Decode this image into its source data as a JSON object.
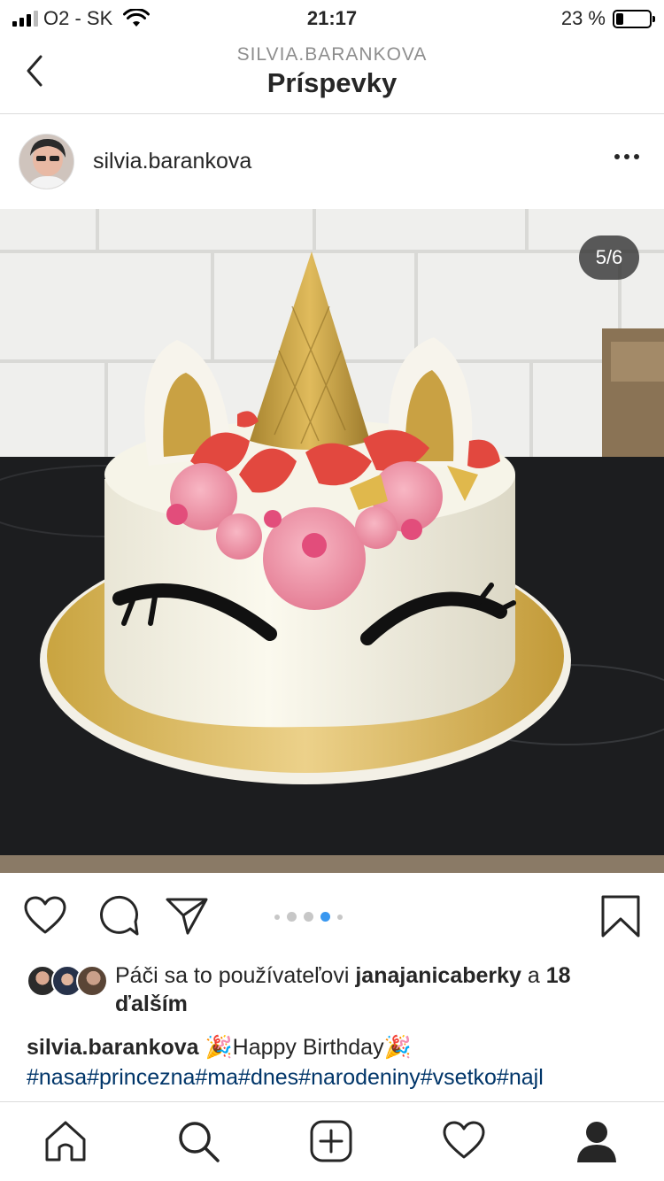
{
  "status_bar": {
    "carrier": "O2 - SK",
    "time": "21:17",
    "battery_percent_label": "23 %",
    "battery_level": 0.23
  },
  "header": {
    "subtitle": "SILVIA.BARANKOVA",
    "title": "Príspevky",
    "back_icon": "chevron-left-icon"
  },
  "post": {
    "username": "silvia.barankova",
    "more_icon": "ellipsis-icon",
    "image_counter": "5/6",
    "carousel": {
      "total_dots": 5,
      "active_index": 3
    },
    "actions": [
      "heart-icon",
      "comment-icon",
      "share-icon",
      "bookmark-icon"
    ],
    "likes": {
      "prefix": "Páči sa to používateľovi",
      "liker": "janajanicaberky",
      "connector": "a",
      "others": "18 ďalším"
    },
    "caption": {
      "author": "silvia.barankova",
      "text": "🎉Happy Birthday🎉",
      "hashtags": "#nasa#princezna#ma#dnes#narodeniny#vsetko#najl"
    }
  },
  "tab_bar": [
    "home-icon",
    "search-icon",
    "new-post-icon",
    "activity-heart-icon",
    "profile-icon"
  ],
  "colors": {
    "link": "#003569",
    "active_dot": "#3897f0",
    "divider": "#dbdbdb"
  }
}
